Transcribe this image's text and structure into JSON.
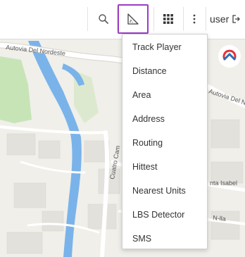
{
  "toolbar": {
    "user_label": "user",
    "icons": {
      "search": "search-icon",
      "measure": "measure-ruler-icon",
      "apps": "grid-apps-icon",
      "more": "more-vertical-icon",
      "logout": "logout-icon"
    },
    "active_color": "#9b3cc5"
  },
  "menu": {
    "items": [
      {
        "label": "Track Player"
      },
      {
        "label": "Distance"
      },
      {
        "label": "Area"
      },
      {
        "label": "Address"
      },
      {
        "label": "Routing"
      },
      {
        "label": "Hittest"
      },
      {
        "label": "Nearest Units"
      },
      {
        "label": "LBS Detector"
      },
      {
        "label": "SMS"
      }
    ]
  },
  "map": {
    "labels": {
      "autovia": "Autovia Del Nordeste",
      "autovia_right": "Autovia Del Norde",
      "santa_isabel": "nta Isabel",
      "nila": "N-lla",
      "cuatro": "Cuatro Cam"
    },
    "colors": {
      "river": "#7ab3ea",
      "green": "#bfe3b0",
      "road": "#ffffff",
      "block": "#dcdad5"
    }
  },
  "brand": {
    "logo_icon": "brand-logo-icon",
    "logo_colors": [
      "#e5323b",
      "#2b6cb8"
    ]
  }
}
